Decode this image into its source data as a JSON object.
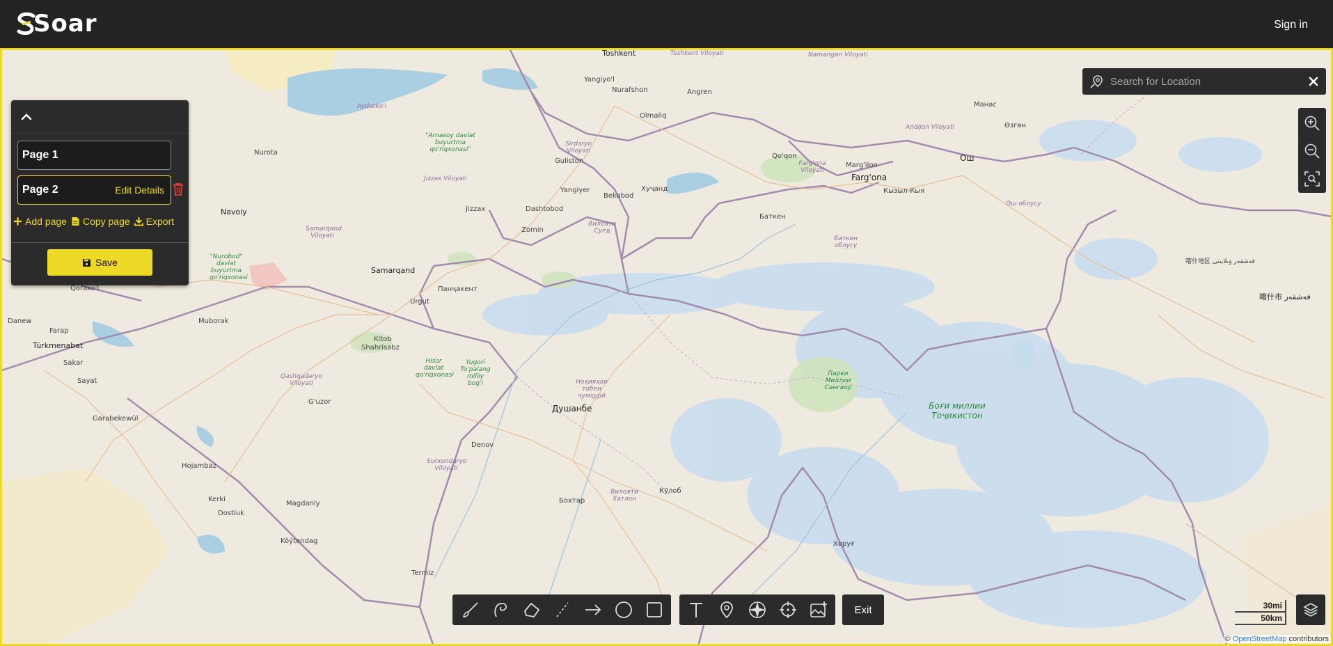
{
  "app": {
    "brand": "Soar",
    "sign_in": "Sign in"
  },
  "colors": {
    "accent": "#eed926",
    "panel_bg": "#2b2b2b",
    "header_bg": "#232323",
    "danger": "#e53935"
  },
  "panel": {
    "pages": [
      {
        "label": "Page 1"
      },
      {
        "label": "Page 2",
        "edit_label": "Edit Details"
      }
    ],
    "actions": {
      "add": "Add page",
      "copy": "Copy page",
      "export": "Export"
    },
    "save": "Save"
  },
  "search": {
    "placeholder": "Search for Location"
  },
  "toolbar": {
    "draw_tools": [
      "brush-icon",
      "freehand-icon",
      "polygon-icon",
      "polyline-icon",
      "arrow-icon",
      "circle-icon",
      "rectangle-icon"
    ],
    "marker_tools": [
      "text-icon",
      "pin-icon",
      "compass-icon",
      "crosshair-icon",
      "image-icon"
    ],
    "exit": "Exit"
  },
  "map": {
    "scale": [
      "30mi",
      "50km"
    ],
    "attribution_prefix": "©",
    "attribution_link": "OpenStreetMap",
    "attribution_suffix": " contributors",
    "places": {
      "toshkent": "Toshkent",
      "toshkent_viloyati": "Toshkent Viloyati",
      "namangan_viloyati": "Namangan Viloyati",
      "namangan": "Namangan",
      "manas": "Манас",
      "ozgon": "Өзгөн",
      "andijon_viloyati": "Andijon Viloyati",
      "yangiyol": "Yangiyo'l",
      "nurafshon": "Nurafshon",
      "angren": "Angren",
      "olmaliq": "Olmaliq",
      "nurota": "Nurota",
      "arnasoy": "\"Arnasoy davlat buyurtma qo'riqxonasi\"",
      "sirdaryo_viloyati": "Sirdaryo Viloyati",
      "guliston": "Guliston",
      "qoqon": "Qo'qon",
      "margilon": "Marg'ilon",
      "fargona": "Farg'ona",
      "fargona_viloyati": "Farg'ona Viloyati",
      "osh": "Ош",
      "kyzyl_kyya": "Кызыл-Кыя",
      "osh_oblusu": "Ош облусу",
      "aydarkol": "Aydarko'l",
      "jizzax_viloyati": "Jizzax Viloyati",
      "yangiyer": "Yangiyer",
      "bekobod": "Bekobod",
      "khujand": "Хуҷанд",
      "navoiy": "Navoiy",
      "jizzax": "Jizzax",
      "dashtobod": "Dashtobod",
      "zomin": "Zomin",
      "viloyati_sugd": "Вилояти Суғд",
      "batken": "Баткен",
      "batken_oblusu": "Баткен облусу",
      "samarqand_viloyati": "Samarqand Viloyati",
      "nurobod": "\"Nurobod\" davlat buyurtma qo'riqxonasi",
      "samarqand": "Samarqand",
      "panjakent": "Панҷакент",
      "urgut": "Urgut",
      "qorakol": "Qorako'l",
      "danew": "Danew",
      "farap": "Farap",
      "turkmenabat": "Türkmenabat",
      "muborak": "Muborak",
      "kitob": "Kitob",
      "shahrisabz": "Shahrisabz",
      "hisor": "Hisor davlat qo'riqxonasi",
      "yugori": "Yugori To'palang milliy bog'i",
      "sakar": "Sakar",
      "sayat": "Sayat",
      "qashqadaryo": "Qashqadaryo Viloyati",
      "guzor": "G'uzor",
      "nohiyahoi": "Ноҳияҳои тобеи ҷумҳурӣ",
      "dushanbe": "Душанбе",
      "parki": "Парки Миллии Сангвор",
      "bogi": "Боғи миллии Тоҷикистон",
      "garabekewul": "Garabekewül",
      "denov": "Denov",
      "surxondaryo": "Surxondaryo Viloyati",
      "hojambaz": "Hojambaz",
      "kerki": "Kerki",
      "dostluk": "Dostluk",
      "magdanly": "Magdanly",
      "viloyati_khatlon": "Вилояти Хатлон",
      "kulob": "Кӯлоб",
      "bokhtar": "Бохтар",
      "khorug": "Хоруғ",
      "koytendag": "Köýtendag",
      "termiz": "Termiz",
      "kashgar": "喀什市 قەشقەر",
      "kashgar_region": "喀什地区 قەشقەر ۋىلايىتى"
    }
  }
}
